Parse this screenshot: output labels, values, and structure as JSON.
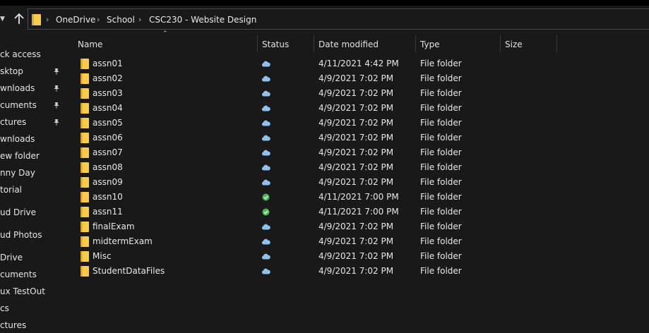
{
  "breadcrumb": [
    "OneDrive",
    "School",
    "CSC230 - Website Design"
  ],
  "columns": {
    "name": "Name",
    "status": "Status",
    "date": "Date modified",
    "type": "Type",
    "size": "Size"
  },
  "sidebar": [
    {
      "label": "ck access",
      "pinned": false
    },
    {
      "label": "sktop",
      "pinned": true
    },
    {
      "label": "wnloads",
      "pinned": true
    },
    {
      "label": "cuments",
      "pinned": true
    },
    {
      "label": "ctures",
      "pinned": true
    },
    {
      "label": "wnloads",
      "pinned": false
    },
    {
      "label": "ew folder",
      "pinned": false
    },
    {
      "label": "nny Day",
      "pinned": false
    },
    {
      "label": "torial",
      "pinned": false
    },
    {
      "label": "ud Drive",
      "pinned": false
    },
    {
      "label": "ud Photos",
      "pinned": false
    },
    {
      "label": "Drive",
      "pinned": false
    },
    {
      "label": "cuments",
      "pinned": false
    },
    {
      "label": "ux TestOut",
      "pinned": false
    },
    {
      "label": "cs",
      "pinned": false
    },
    {
      "label": "ctures",
      "pinned": false
    }
  ],
  "files": [
    {
      "name": "assn01",
      "status": "cloud",
      "date": "4/11/2021 4:42 PM",
      "type": "File folder"
    },
    {
      "name": "assn02",
      "status": "cloud",
      "date": "4/9/2021 7:02 PM",
      "type": "File folder"
    },
    {
      "name": "assn03",
      "status": "cloud",
      "date": "4/9/2021 7:02 PM",
      "type": "File folder"
    },
    {
      "name": "assn04",
      "status": "cloud",
      "date": "4/9/2021 7:02 PM",
      "type": "File folder"
    },
    {
      "name": "assn05",
      "status": "cloud",
      "date": "4/9/2021 7:02 PM",
      "type": "File folder"
    },
    {
      "name": "assn06",
      "status": "cloud",
      "date": "4/9/2021 7:02 PM",
      "type": "File folder"
    },
    {
      "name": "assn07",
      "status": "cloud",
      "date": "4/9/2021 7:02 PM",
      "type": "File folder"
    },
    {
      "name": "assn08",
      "status": "cloud",
      "date": "4/9/2021 7:02 PM",
      "type": "File folder"
    },
    {
      "name": "assn09",
      "status": "cloud",
      "date": "4/9/2021 7:02 PM",
      "type": "File folder"
    },
    {
      "name": "assn10",
      "status": "synced",
      "date": "4/11/2021 7:00 PM",
      "type": "File folder"
    },
    {
      "name": "assn11",
      "status": "synced",
      "date": "4/11/2021 7:00 PM",
      "type": "File folder"
    },
    {
      "name": "finalExam",
      "status": "cloud",
      "date": "4/9/2021 7:02 PM",
      "type": "File folder"
    },
    {
      "name": "midtermExam",
      "status": "cloud",
      "date": "4/9/2021 7:02 PM",
      "type": "File folder"
    },
    {
      "name": "Misc",
      "status": "cloud",
      "date": "4/9/2021 7:02 PM",
      "type": "File folder"
    },
    {
      "name": "StudentDataFiles",
      "status": "cloud",
      "date": "4/9/2021 7:02 PM",
      "type": "File folder"
    }
  ],
  "colors": {
    "background": "#191919",
    "folder": "#f7cb4d",
    "cloud": "#8fc1ec",
    "synced": "#46b854"
  },
  "icons": {
    "up": "arrow-up-icon",
    "folder": "folder-icon",
    "cloud": "cloud-icon",
    "synced": "check-circle-icon",
    "pin": "pin-icon"
  }
}
